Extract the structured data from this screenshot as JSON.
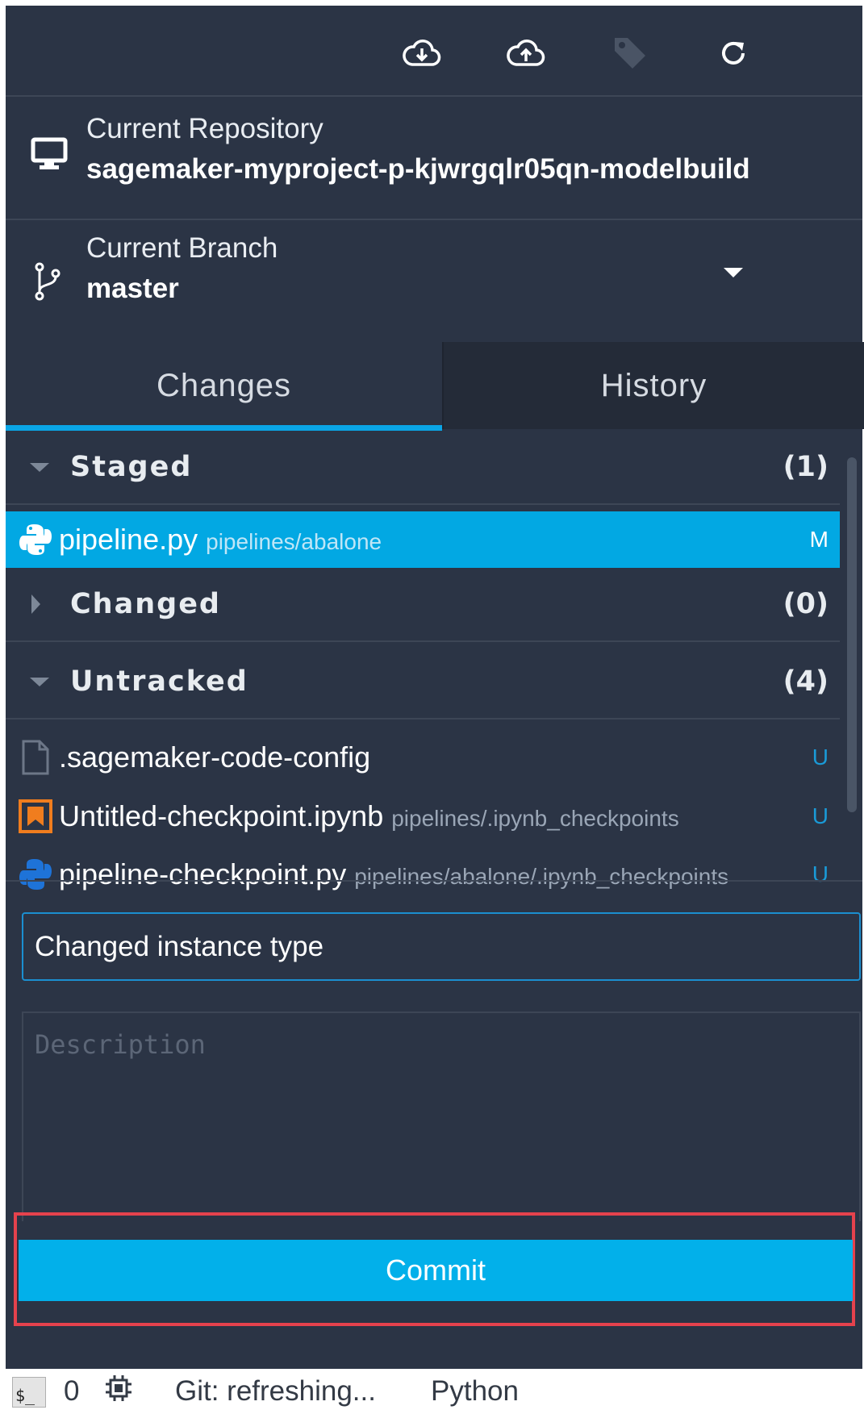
{
  "toolbar": {
    "icons": [
      "cloud-download-icon",
      "cloud-upload-icon",
      "tag-icon",
      "refresh-icon"
    ]
  },
  "repository": {
    "label": "Current Repository",
    "name": "sagemaker-myproject-p-kjwrgqlr05qn-modelbuild"
  },
  "branch": {
    "label": "Current Branch",
    "name": "master"
  },
  "tabs": {
    "changes": "Changes",
    "history": "History"
  },
  "sections": {
    "staged": {
      "title": "Staged",
      "count": "(1)"
    },
    "changed": {
      "title": "Changed",
      "count": "(0)"
    },
    "untracked": {
      "title": "Untracked",
      "count": "(4)"
    }
  },
  "staged_files": [
    {
      "name": "pipeline.py",
      "path": "pipelines/abalone",
      "status": "M",
      "icon": "python-icon"
    }
  ],
  "untracked_files": [
    {
      "name": ".sagemaker-code-config",
      "path": "",
      "status": "U",
      "icon": "file-icon"
    },
    {
      "name": "Untitled-checkpoint.ipynb",
      "path": "pipelines/.ipynb_checkpoints",
      "status": "U",
      "icon": "notebook-icon"
    },
    {
      "name": "pipeline-checkpoint.py",
      "path": "pipelines/abalone/.ipynb_checkpoints",
      "status": "U",
      "icon": "python-icon"
    }
  ],
  "commit": {
    "summary_value": "Changed instance type",
    "description_placeholder": "Description",
    "button_label": "Commit"
  },
  "statusbar": {
    "terminal_label": "$_",
    "count": "0",
    "git_status": "Git: refreshing...",
    "kernel": "Python"
  },
  "colors": {
    "panel_bg": "#2b3445",
    "accent": "#02a8e3",
    "highlight": "#e5424d"
  }
}
